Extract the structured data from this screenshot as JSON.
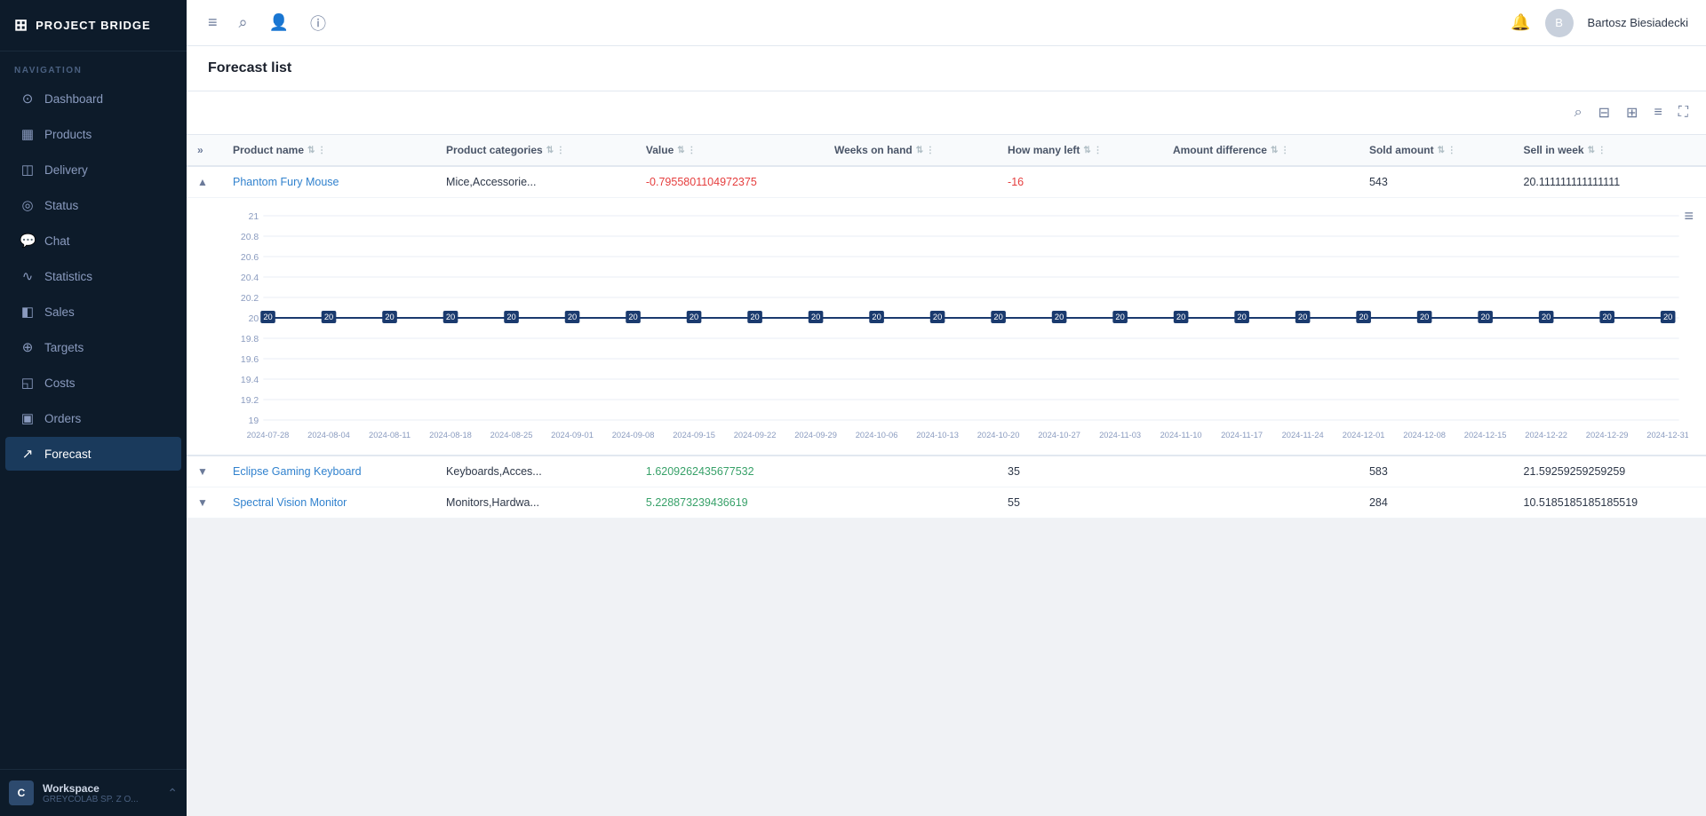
{
  "app": {
    "logo": "PROJECT BRIDGE",
    "logo_icon": "⊞"
  },
  "sidebar": {
    "nav_label": "NAVIGATION",
    "items": [
      {
        "id": "dashboard",
        "label": "Dashboard",
        "icon": "⊙",
        "active": false
      },
      {
        "id": "products",
        "label": "Products",
        "icon": "▦",
        "active": false
      },
      {
        "id": "delivery",
        "label": "Delivery",
        "icon": "◫",
        "active": false
      },
      {
        "id": "status",
        "label": "Status",
        "icon": "◎",
        "active": false
      },
      {
        "id": "chat",
        "label": "Chat",
        "icon": "◉",
        "active": false
      },
      {
        "id": "statistics",
        "label": "Statistics",
        "icon": "∿",
        "active": false
      },
      {
        "id": "sales",
        "label": "Sales",
        "icon": "◧",
        "active": false
      },
      {
        "id": "targets",
        "label": "Targets",
        "icon": "⊕",
        "active": false
      },
      {
        "id": "costs",
        "label": "Costs",
        "icon": "◱",
        "active": false
      },
      {
        "id": "orders",
        "label": "Orders",
        "icon": "▣",
        "active": false
      },
      {
        "id": "forecast",
        "label": "Forecast",
        "icon": "↗",
        "active": true
      }
    ],
    "footer": {
      "initial": "C",
      "workspace": "Workspace",
      "company": "GREYCOLAB SP. Z O..."
    }
  },
  "topbar": {
    "icons": [
      "≡",
      "⌕",
      "👤",
      "ⓘ"
    ],
    "username": "Bartosz Biesiadecki"
  },
  "page": {
    "title": "Forecast list"
  },
  "toolbar": {
    "icons": [
      "⌕",
      "⊟",
      "⊞",
      "≡",
      "⛶"
    ]
  },
  "table": {
    "columns": [
      {
        "id": "expand",
        "label": ""
      },
      {
        "id": "product_name",
        "label": "Product name"
      },
      {
        "id": "categories",
        "label": "Product categories"
      },
      {
        "id": "value",
        "label": "Value"
      },
      {
        "id": "weeks_on_hand",
        "label": "Weeks on hand"
      },
      {
        "id": "how_many_left",
        "label": "How many left"
      },
      {
        "id": "amount_diff",
        "label": "Amount difference"
      },
      {
        "id": "sold_amount",
        "label": "Sold amount"
      },
      {
        "id": "sell_in_week",
        "label": "Sell in week"
      }
    ],
    "rows": [
      {
        "id": 1,
        "expand": "▲",
        "product_name": "Phantom Fury Mouse",
        "categories": "Mice,Accessorie...",
        "value": "-0.7955801104972375",
        "weeks_on_hand": "",
        "how_many_left": "-16",
        "amount_diff": "",
        "sold_amount": "543",
        "sell_in_week": "20.111111111111111",
        "value_type": "negative",
        "expanded": true
      },
      {
        "id": 2,
        "expand": "▼",
        "product_name": "Eclipse Gaming Keyboard",
        "categories": "Keyboards,Acces...",
        "value": "1.6209262435677532",
        "weeks_on_hand": "",
        "how_many_left": "35",
        "amount_diff": "",
        "sold_amount": "583",
        "sell_in_week": "21.59259259259259",
        "value_type": "positive",
        "expanded": false
      },
      {
        "id": 3,
        "expand": "▼",
        "product_name": "Spectral Vision Monitor",
        "categories": "Monitors,Hardwa...",
        "value": "5.228873239436619",
        "weeks_on_hand": "",
        "how_many_left": "55",
        "amount_diff": "",
        "sold_amount": "284",
        "sell_in_week": "10.5185185185185519",
        "value_type": "positive",
        "expanded": false
      }
    ]
  },
  "chart": {
    "y_labels": [
      "21",
      "20.8",
      "20.6",
      "20.4",
      "20.2",
      "20",
      "19.8",
      "19.6",
      "19.4",
      "19.2",
      "19"
    ],
    "x_labels": [
      "2024-07-28",
      "2024-08-04",
      "2024-08-11",
      "2024-08-18",
      "2024-08-25",
      "2024-09-01",
      "2024-09-08",
      "2024-09-15",
      "2024-09-22",
      "2024-09-29",
      "2024-10-06",
      "2024-10-13",
      "2024-10-20",
      "2024-10-27",
      "2024-11-03",
      "2024-11-10",
      "2024-11-17",
      "2024-11-24",
      "2024-12-01",
      "2024-12-08",
      "2024-12-15",
      "2024-12-22",
      "2024-12-29",
      "2024-12-31"
    ],
    "data_value": "20",
    "data_points_count": 24
  }
}
